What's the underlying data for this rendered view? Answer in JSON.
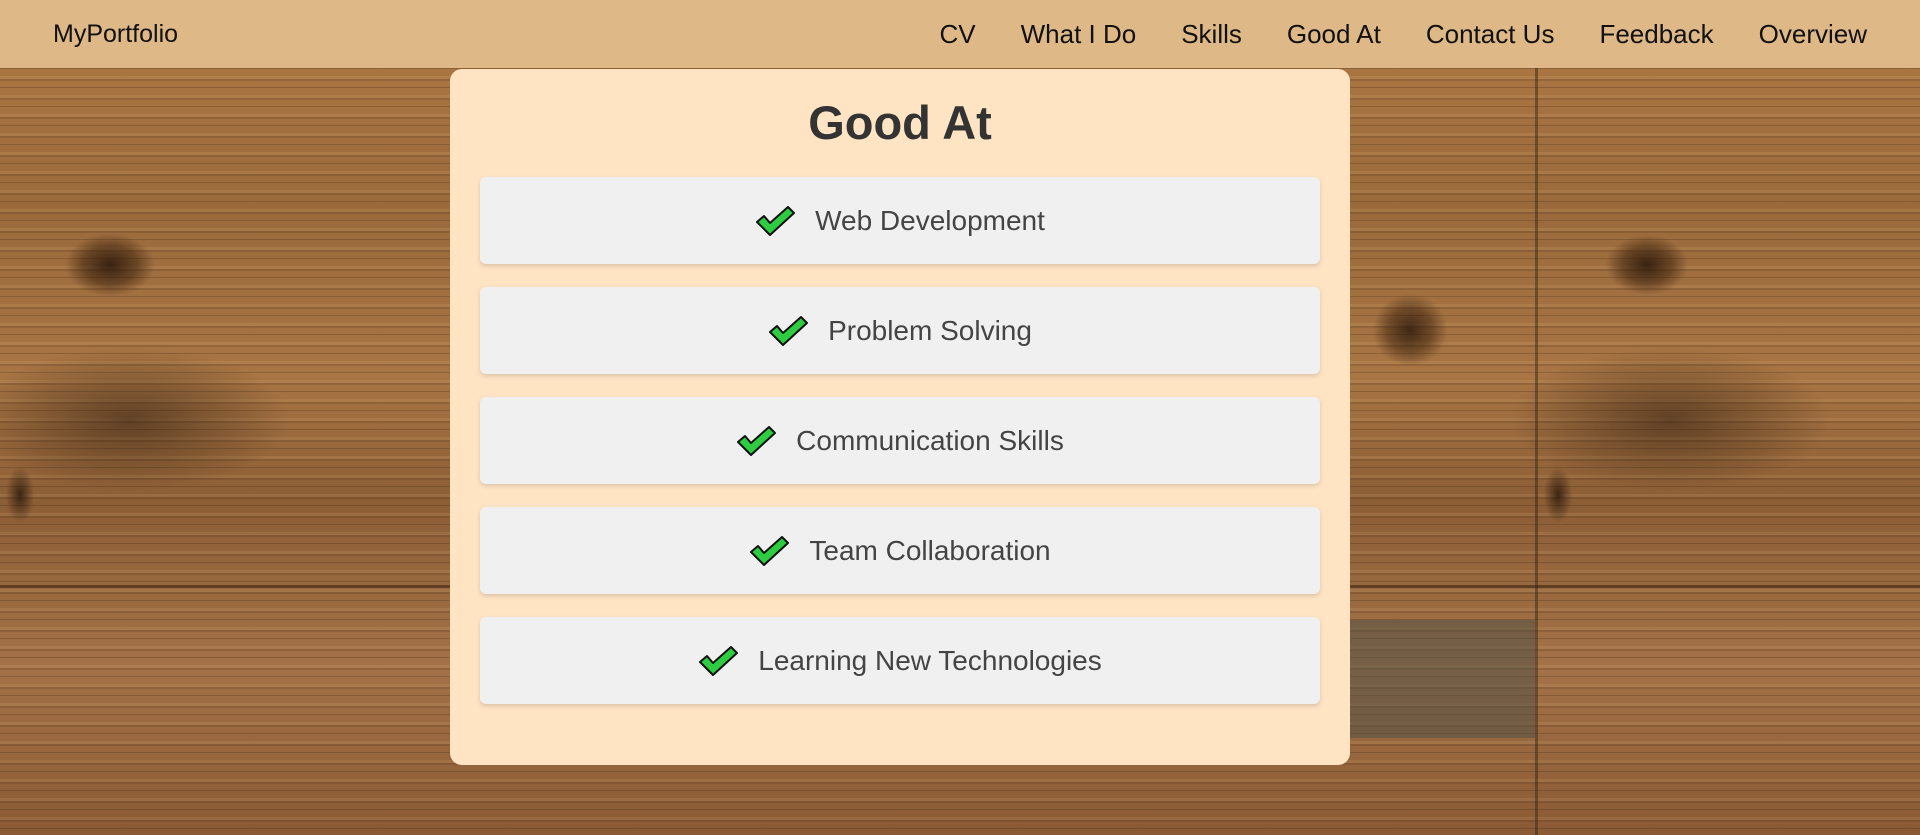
{
  "nav": {
    "brand": "MyPortfolio",
    "links": [
      {
        "label": "CV"
      },
      {
        "label": "What I Do"
      },
      {
        "label": "Skills"
      },
      {
        "label": "Good At"
      },
      {
        "label": "Contact Us"
      },
      {
        "label": "Feedback"
      },
      {
        "label": "Overview"
      }
    ]
  },
  "main": {
    "title": "Good At",
    "items": [
      {
        "label": "Web Development",
        "icon": "checkmark-icon"
      },
      {
        "label": "Problem Solving",
        "icon": "checkmark-icon"
      },
      {
        "label": "Communication Skills",
        "icon": "checkmark-icon"
      },
      {
        "label": "Team Collaboration",
        "icon": "checkmark-icon"
      },
      {
        "label": "Learning New Technologies",
        "icon": "checkmark-icon"
      }
    ]
  },
  "colors": {
    "navbar_bg": "#deb887",
    "card_bg": "#ffe4c4",
    "item_bg": "#f0f0f0",
    "check_green": "#2ecc40"
  }
}
